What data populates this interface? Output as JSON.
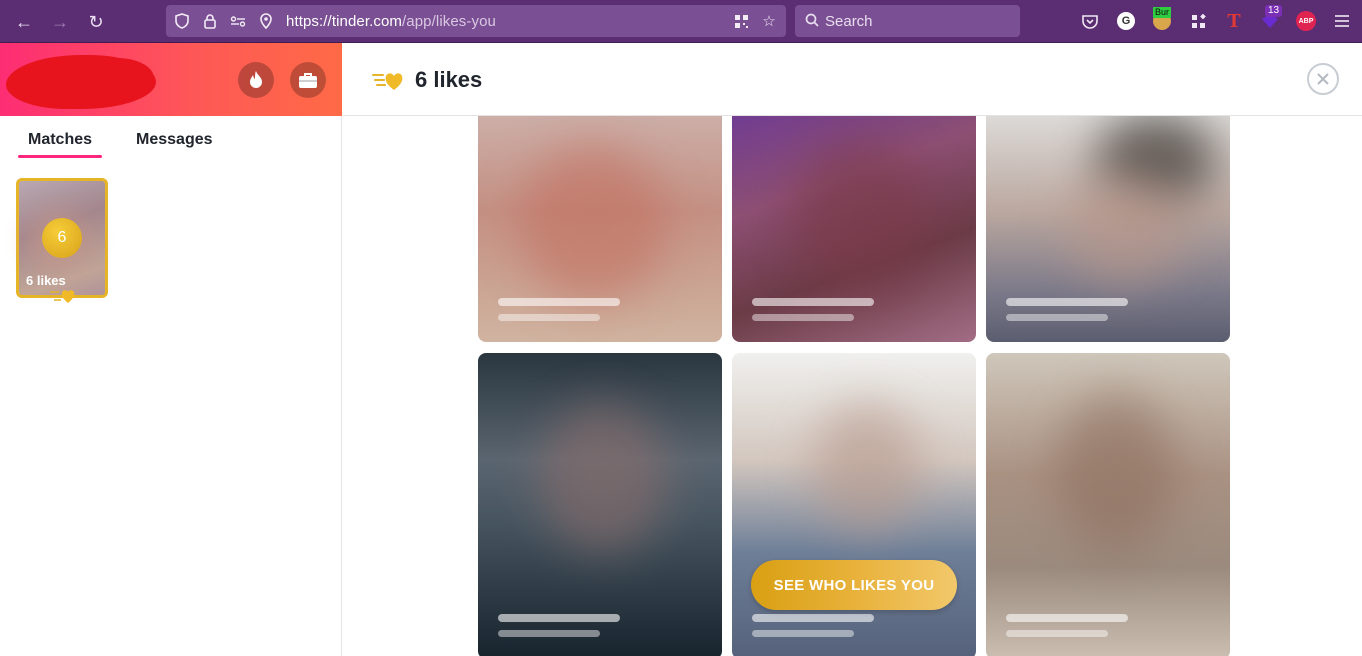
{
  "browser": {
    "url_host": "https://tinder.com",
    "url_path": "/app/likes-you",
    "search_placeholder": "Search",
    "extensions": {
      "g_label": "G",
      "bur_label": "Bur",
      "t_label": "T",
      "badge_count": "13",
      "abp_label": "ABP"
    }
  },
  "sidebar": {
    "tabs": [
      {
        "label": "Matches"
      },
      {
        "label": "Messages"
      }
    ],
    "likes_card": {
      "count": "6",
      "label": "6 likes"
    }
  },
  "main": {
    "title": "6 likes",
    "see_button_label": "SEE WHO LIKES YOU"
  },
  "colors": {
    "brand_gradient_start": "#fd2d74",
    "brand_gradient_end": "#ff6a46",
    "gold": "#e6b427",
    "browser_chrome": "#5b2d73"
  }
}
